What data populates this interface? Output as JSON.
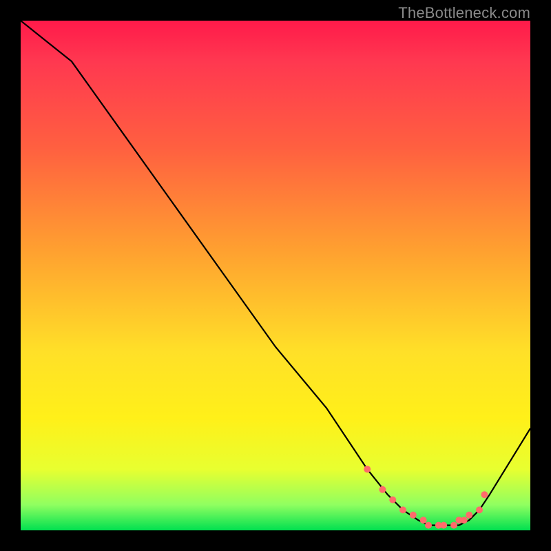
{
  "watermark": "TheBottleneck.com",
  "chart_data": {
    "type": "line",
    "title": "",
    "xlabel": "",
    "ylabel": "",
    "xlim": [
      0,
      100
    ],
    "ylim": [
      0,
      100
    ],
    "series": [
      {
        "name": "curve",
        "x": [
          0,
          5,
          10,
          20,
          30,
          40,
          50,
          60,
          68,
          72,
          75,
          78,
          80,
          82,
          84,
          86,
          88,
          90,
          92,
          100
        ],
        "y": [
          100,
          96,
          92,
          78,
          64,
          50,
          36,
          24,
          12,
          7,
          4,
          2,
          1,
          1,
          1,
          1,
          2,
          4,
          7,
          20
        ]
      }
    ],
    "markers": {
      "name": "optimal-zone",
      "x": [
        68,
        71,
        73,
        75,
        77,
        79,
        80,
        82,
        83,
        85,
        86,
        87,
        88,
        90,
        91
      ],
      "y": [
        12,
        8,
        6,
        4,
        3,
        2,
        1,
        1,
        1,
        1,
        2,
        2,
        3,
        4,
        7
      ]
    },
    "colors": {
      "line": "#000000",
      "marker": "#ff6b6b"
    }
  }
}
